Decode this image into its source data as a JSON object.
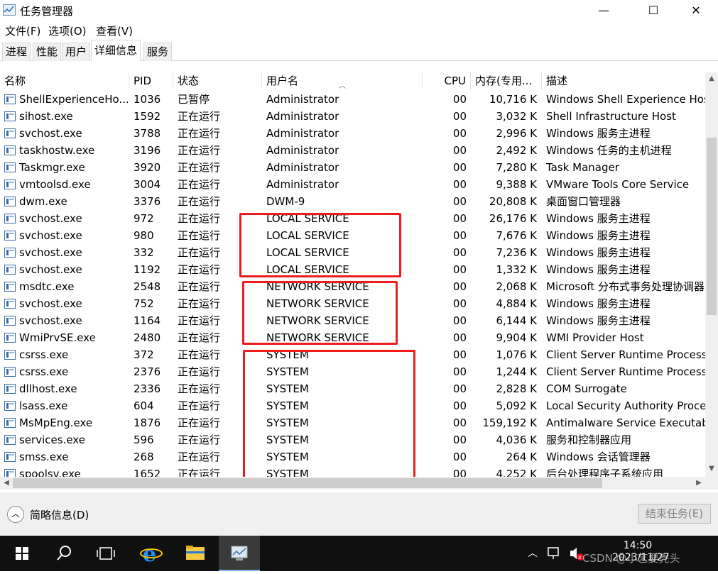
{
  "window": {
    "title": "任务管理器",
    "minimize": "—",
    "maximize": "☐",
    "close": "✕"
  },
  "menu": [
    "文件(F)",
    "选项(O)",
    "查看(V)"
  ],
  "tabs": [
    "进程",
    "性能",
    "用户",
    "详细信息",
    "服务"
  ],
  "active_tab": "详细信息",
  "columns": {
    "name": "名称",
    "pid": "PID",
    "status": "状态",
    "user": "用户名",
    "cpu": "CPU",
    "memory": "内存(专用...",
    "desc": "描述"
  },
  "rows": [
    {
      "name": "ShellExperienceHo...",
      "pid": "1036",
      "status": "已暂停",
      "user": "Administrator",
      "cpu": "00",
      "memory": "10,716 K",
      "desc": "Windows Shell Experience Host",
      "icon": "app-icon"
    },
    {
      "name": "sihost.exe",
      "pid": "1592",
      "status": "正在运行",
      "user": "Administrator",
      "cpu": "00",
      "memory": "3,032 K",
      "desc": "Shell Infrastructure Host",
      "icon": "app-icon"
    },
    {
      "name": "svchost.exe",
      "pid": "3788",
      "status": "正在运行",
      "user": "Administrator",
      "cpu": "00",
      "memory": "2,996 K",
      "desc": "Windows 服务主进程",
      "icon": "app-icon"
    },
    {
      "name": "taskhostw.exe",
      "pid": "3196",
      "status": "正在运行",
      "user": "Administrator",
      "cpu": "00",
      "memory": "2,492 K",
      "desc": "Windows 任务的主机进程",
      "icon": "app-icon"
    },
    {
      "name": "Taskmgr.exe",
      "pid": "3920",
      "status": "正在运行",
      "user": "Administrator",
      "cpu": "00",
      "memory": "7,280 K",
      "desc": "Task Manager",
      "icon": "taskmgr-icon"
    },
    {
      "name": "vmtoolsd.exe",
      "pid": "3004",
      "status": "正在运行",
      "user": "Administrator",
      "cpu": "00",
      "memory": "9,388 K",
      "desc": "VMware Tools Core Service",
      "icon": "vm-icon"
    },
    {
      "name": "dwm.exe",
      "pid": "3376",
      "status": "正在运行",
      "user": "DWM-9",
      "cpu": "00",
      "memory": "20,808 K",
      "desc": "桌面窗口管理器",
      "icon": "app-icon"
    },
    {
      "name": "svchost.exe",
      "pid": "972",
      "status": "正在运行",
      "user": "LOCAL SERVICE",
      "cpu": "00",
      "memory": "26,176 K",
      "desc": "Windows 服务主进程",
      "icon": "app-icon"
    },
    {
      "name": "svchost.exe",
      "pid": "980",
      "status": "正在运行",
      "user": "LOCAL SERVICE",
      "cpu": "00",
      "memory": "7,676 K",
      "desc": "Windows 服务主进程",
      "icon": "app-icon"
    },
    {
      "name": "svchost.exe",
      "pid": "332",
      "status": "正在运行",
      "user": "LOCAL SERVICE",
      "cpu": "00",
      "memory": "7,236 K",
      "desc": "Windows 服务主进程",
      "icon": "app-icon"
    },
    {
      "name": "svchost.exe",
      "pid": "1192",
      "status": "正在运行",
      "user": "LOCAL SERVICE",
      "cpu": "00",
      "memory": "1,332 K",
      "desc": "Windows 服务主进程",
      "icon": "app-icon"
    },
    {
      "name": "msdtc.exe",
      "pid": "2548",
      "status": "正在运行",
      "user": "NETWORK SERVICE",
      "cpu": "00",
      "memory": "2,068 K",
      "desc": "Microsoft 分布式事务处理协调器",
      "icon": "msdtc-icon"
    },
    {
      "name": "svchost.exe",
      "pid": "752",
      "status": "正在运行",
      "user": "NETWORK SERVICE",
      "cpu": "00",
      "memory": "4,884 K",
      "desc": "Windows 服务主进程",
      "icon": "app-icon"
    },
    {
      "name": "svchost.exe",
      "pid": "1164",
      "status": "正在运行",
      "user": "NETWORK SERVICE",
      "cpu": "00",
      "memory": "6,144 K",
      "desc": "Windows 服务主进程",
      "icon": "app-icon"
    },
    {
      "name": "WmiPrvSE.exe",
      "pid": "2480",
      "status": "正在运行",
      "user": "NETWORK SERVICE",
      "cpu": "00",
      "memory": "9,904 K",
      "desc": "WMI Provider Host",
      "icon": "wmi-icon"
    },
    {
      "name": "csrss.exe",
      "pid": "372",
      "status": "正在运行",
      "user": "SYSTEM",
      "cpu": "00",
      "memory": "1,076 K",
      "desc": "Client Server Runtime Process",
      "icon": "app-icon"
    },
    {
      "name": "csrss.exe",
      "pid": "2376",
      "status": "正在运行",
      "user": "SYSTEM",
      "cpu": "00",
      "memory": "1,244 K",
      "desc": "Client Server Runtime Process",
      "icon": "app-icon"
    },
    {
      "name": "dllhost.exe",
      "pid": "2336",
      "status": "正在运行",
      "user": "SYSTEM",
      "cpu": "00",
      "memory": "2,828 K",
      "desc": "COM Surrogate",
      "icon": "app-icon"
    },
    {
      "name": "lsass.exe",
      "pid": "604",
      "status": "正在运行",
      "user": "SYSTEM",
      "cpu": "00",
      "memory": "5,092 K",
      "desc": "Local Security Authority Process",
      "icon": "app-icon"
    },
    {
      "name": "MsMpEng.exe",
      "pid": "1876",
      "status": "正在运行",
      "user": "SYSTEM",
      "cpu": "00",
      "memory": "159,192 K",
      "desc": "Antimalware Service Executable",
      "icon": "app-icon"
    },
    {
      "name": "services.exe",
      "pid": "596",
      "status": "正在运行",
      "user": "SYSTEM",
      "cpu": "00",
      "memory": "4,036 K",
      "desc": "服务和控制器应用",
      "icon": "app-icon"
    },
    {
      "name": "smss.exe",
      "pid": "268",
      "status": "正在运行",
      "user": "SYSTEM",
      "cpu": "00",
      "memory": "264 K",
      "desc": "Windows 会话管理器",
      "icon": "app-icon"
    },
    {
      "name": "spoolsv.exe",
      "pid": "1652",
      "status": "正在运行",
      "user": "SYSTEM",
      "cpu": "00",
      "memory": "4,252 K",
      "desc": "后台处理程序子系统应用",
      "icon": "printer-icon"
    }
  ],
  "highlight_color": "#ee1c1c",
  "footer": {
    "fewer_details": "简略信息(D)",
    "end_task": "结束任务(E)"
  },
  "taskbar": {
    "time": "14:50",
    "date": "2023/11/27",
    "watermark": "CSDN @小艺要秃头"
  }
}
